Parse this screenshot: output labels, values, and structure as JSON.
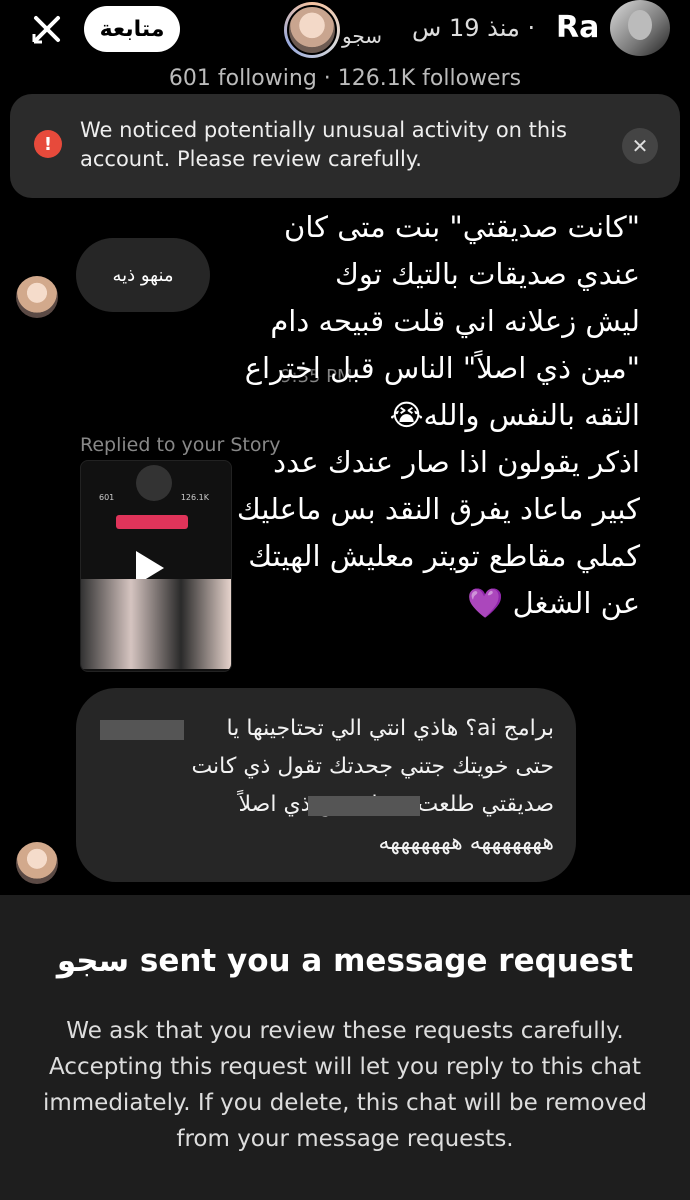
{
  "header": {
    "follow_label": "متابعة",
    "story_user": "Ra",
    "story_time": "· منذ 19 س",
    "story_name": "سجو",
    "stats": "601 following · 126.1K followers"
  },
  "warning": {
    "text": "We noticed potentially unusual activity on this account. Please review carefully.",
    "icon": "alert-icon",
    "close_icon": "close-icon"
  },
  "chat": {
    "small_bubble_text": "منهو ذيه",
    "timestamp": "9:35 PM",
    "replied_label": "Replied to your Story",
    "overlay_text": "\"كانت صديقتي\" بنت متى كان\nعندي صديقات بالتيك توك\nليش زعلانه اني قلت قبيحه دام\n\"مين ذي اصلاً\" الناس قبل اختراع\nالثقه بالنفس والله😭\nاذكر يقولون اذا صار عندك عدد\nكبير ماعاد يفرق النقد بس ماعليك\nكملي مقاطع تويتر معليش الهيتك\nعن الشغل 💜",
    "big_bubble_text": "برامج ai؟ هاذي انتي الي  تحتاجينها يا\nحتى خويتك جتني جحدتك تقول ذي كانت\nصديقتي طلعت            تسبك مين ذي اصلاً\nهههههههه هههههههه"
  },
  "story_preview": {
    "stat_following": "601",
    "stat_followers": "126.1K"
  },
  "request": {
    "title": "سجو sent you a message request",
    "body": "We ask that you review these requests carefully. Accepting this request will let you reply to this chat immediately. If you delete, this chat will be removed from your message requests."
  }
}
